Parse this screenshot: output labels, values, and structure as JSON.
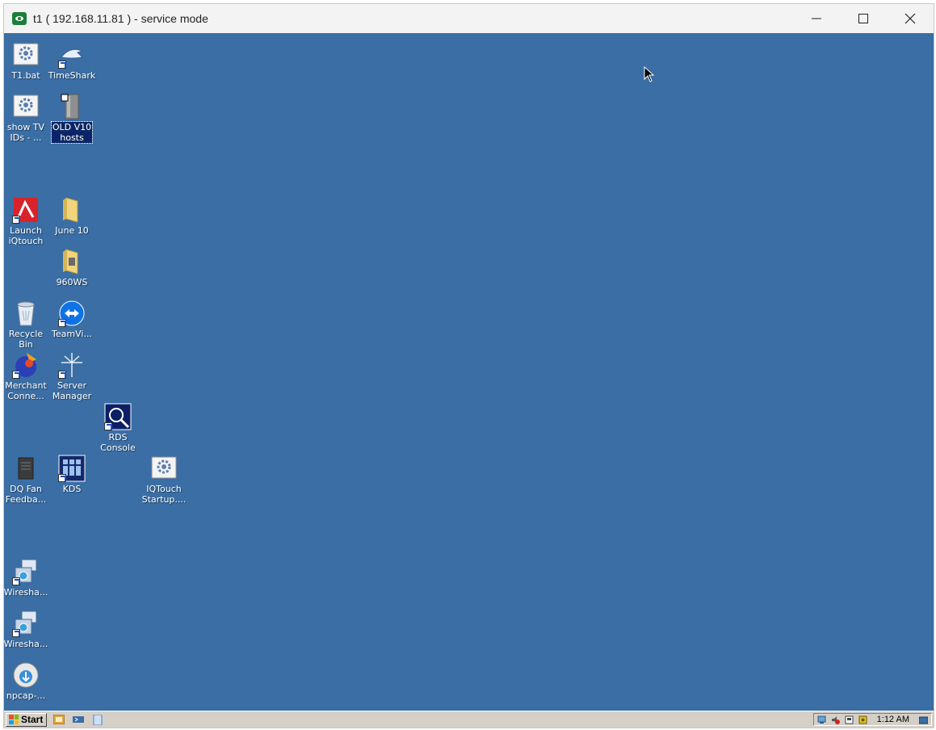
{
  "window": {
    "title": "t1 ( 192.168.11.81 ) - service mode"
  },
  "desktop": {
    "icons": [
      {
        "label": "T1.bat"
      },
      {
        "label": "TimeShark"
      },
      {
        "label": "show TV\nIDs - ..."
      },
      {
        "label": "OLD V10\nhosts"
      },
      {
        "label": "Launch\niQtouch"
      },
      {
        "label": "June 10"
      },
      {
        "label": "960WS"
      },
      {
        "label": "Recycle\nBin"
      },
      {
        "label": "TeamVi..."
      },
      {
        "label": "Merchant\nConne..."
      },
      {
        "label": "Server\nManager"
      },
      {
        "label": "RDS\nConsole"
      },
      {
        "label": "DQ Fan\nFeedba..."
      },
      {
        "label": "KDS"
      },
      {
        "label": "IQTouch\nStartup...."
      },
      {
        "label": "Wiresha..."
      },
      {
        "label": "Wiresha..."
      },
      {
        "label": "npcap-..."
      }
    ]
  },
  "taskbar": {
    "start_label": "Start",
    "clock": "1:12 AM"
  }
}
